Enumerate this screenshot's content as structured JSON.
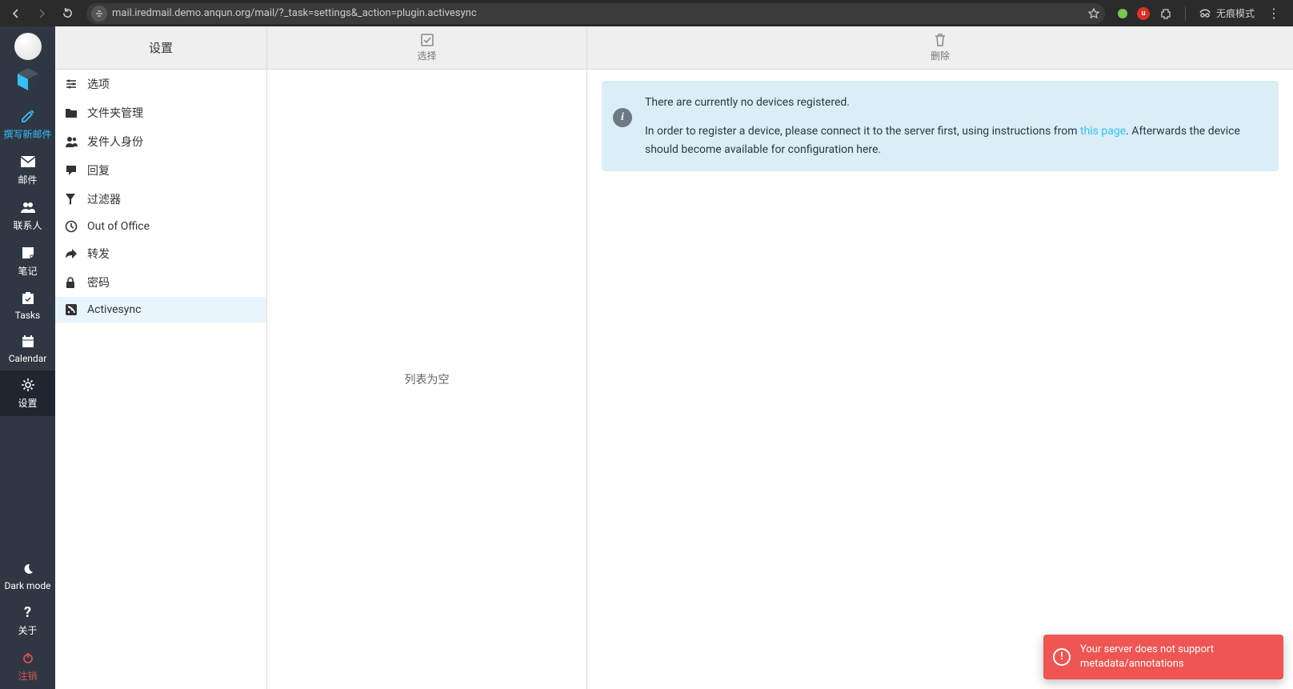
{
  "browser": {
    "url": "mail.iredmail.demo.anqun.org/mail/?_task=settings&_action=plugin.activesync",
    "incognito_label": "无痕模式"
  },
  "leftnav": {
    "items": [
      {
        "key": "compose",
        "label": "撰写新邮件"
      },
      {
        "key": "mail",
        "label": "邮件"
      },
      {
        "key": "contacts",
        "label": "联系人"
      },
      {
        "key": "notes",
        "label": "笔记"
      },
      {
        "key": "tasks",
        "label": "Tasks"
      },
      {
        "key": "calendar",
        "label": "Calendar"
      },
      {
        "key": "settings",
        "label": "设置"
      }
    ],
    "bottom": [
      {
        "key": "darkmode",
        "label": "Dark mode"
      },
      {
        "key": "about",
        "label": "关于"
      },
      {
        "key": "logout",
        "label": "注销"
      }
    ]
  },
  "settings_col": {
    "title": "设置",
    "items": [
      {
        "key": "preferences",
        "label": "选项"
      },
      {
        "key": "folders",
        "label": "文件夹管理"
      },
      {
        "key": "identities",
        "label": "发件人身份"
      },
      {
        "key": "responses",
        "label": "回复"
      },
      {
        "key": "filters",
        "label": "过滤器"
      },
      {
        "key": "outofoffice",
        "label": "Out of Office"
      },
      {
        "key": "forward",
        "label": "转发"
      },
      {
        "key": "password",
        "label": "密码"
      },
      {
        "key": "activesync",
        "label": "Activesync"
      }
    ],
    "selected": "activesync"
  },
  "mid_col": {
    "select_label": "选择",
    "empty_text": "列表为空"
  },
  "right_col": {
    "delete_label": "删除",
    "info_line1": "There are currently no devices registered.",
    "info_line2_a": "In order to register a device, please connect it to the server first, using instructions from ",
    "info_link": "this page",
    "info_line2_b": ". Afterwards the device should become available for configuration here."
  },
  "toast": {
    "message": "Your server does not support metadata/annotations"
  }
}
